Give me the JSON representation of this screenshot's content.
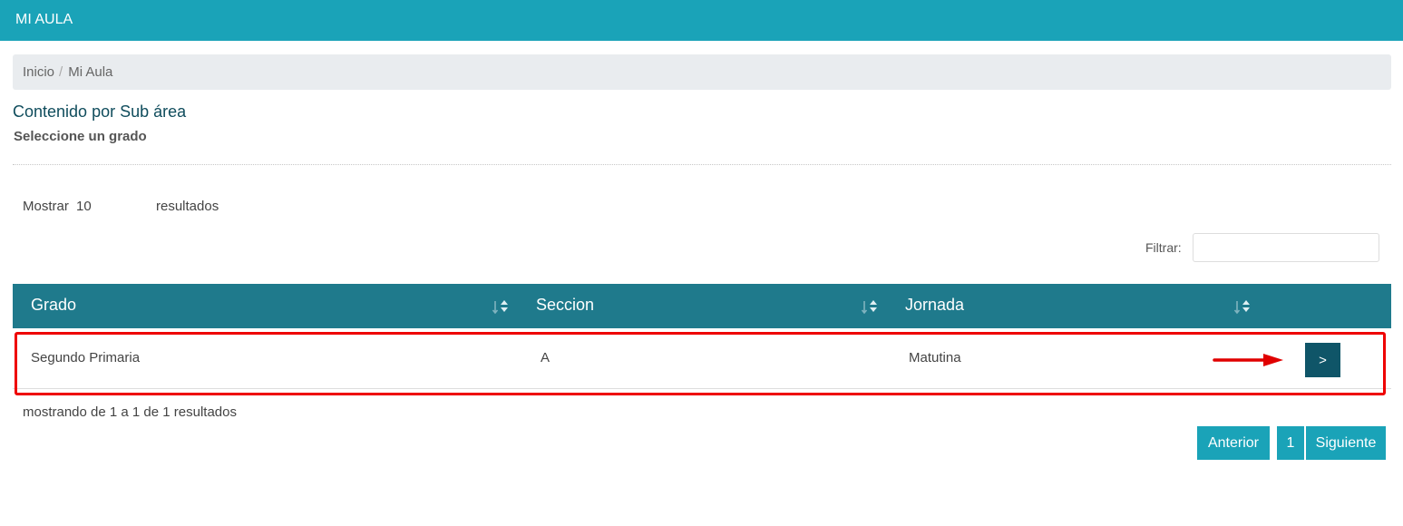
{
  "header": {
    "title": "MI AULA"
  },
  "breadcrumb": {
    "items": [
      "Inicio",
      "Mi Aula"
    ],
    "separator": "/"
  },
  "page": {
    "title": "Contenido por Sub área",
    "subtitle": "Seleccione un grado"
  },
  "length_menu": {
    "prefix": "Mostrar",
    "value": "10",
    "suffix": "resultados"
  },
  "filter": {
    "label": "Filtrar:",
    "value": "",
    "placeholder": ""
  },
  "table": {
    "columns": [
      "Grado",
      "Seccion",
      "Jornada"
    ],
    "rows": [
      {
        "grado": "Segundo Primaria",
        "seccion": "A",
        "jornada": "Matutina",
        "action_label": ">"
      }
    ]
  },
  "info": "mostrando de 1 a 1 de 1 resultados",
  "pagination": {
    "previous": "Anterior",
    "current": "1",
    "next": "Siguiente"
  },
  "icons": {
    "sort": "sort-icon",
    "arrow": "arrow-right-icon"
  },
  "colors": {
    "header_bg": "#1aa3b8",
    "table_header_bg": "#1f7a8c",
    "action_button_bg": "#0f5568",
    "highlight": "#ee0000"
  }
}
